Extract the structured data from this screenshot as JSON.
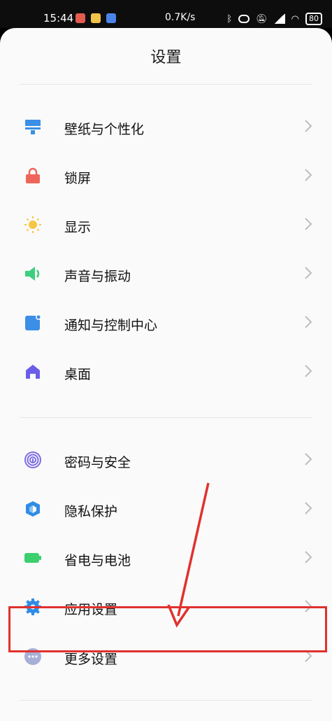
{
  "status_bar": {
    "time": "15:44",
    "net_speed": "0.7K/s",
    "battery": "80"
  },
  "header": {
    "title": "设置"
  },
  "groups": [
    {
      "items": [
        {
          "label": "壁纸与个性化",
          "icon": "wallpaper-brush-icon",
          "color": "#3b8fe6"
        },
        {
          "label": "锁屏",
          "icon": "lock-icon",
          "color": "#f0655a"
        },
        {
          "label": "显示",
          "icon": "sun-icon",
          "color": "#f6c744"
        },
        {
          "label": "声音与振动",
          "icon": "speaker-icon",
          "color": "#3ccf7e"
        },
        {
          "label": "通知与控制中心",
          "icon": "notification-icon",
          "color": "#3b8fe6"
        },
        {
          "label": "桌面",
          "icon": "home-icon",
          "color": "#6a5ee8"
        }
      ]
    },
    {
      "items": [
        {
          "label": "密码与安全",
          "icon": "fingerprint-icon",
          "color": "#7c6de6"
        },
        {
          "label": "隐私保护",
          "icon": "privacy-shield-icon",
          "color": "#2f8de4"
        },
        {
          "label": "省电与电池",
          "icon": "battery-icon",
          "color": "#3ccf6e"
        },
        {
          "label": "应用设置",
          "icon": "gear-icon",
          "color": "#2f8de4"
        },
        {
          "label": "更多设置",
          "icon": "more-dots-icon",
          "color": "#a6b0d6"
        }
      ]
    }
  ],
  "annotation": {
    "color": "#e0322e"
  }
}
